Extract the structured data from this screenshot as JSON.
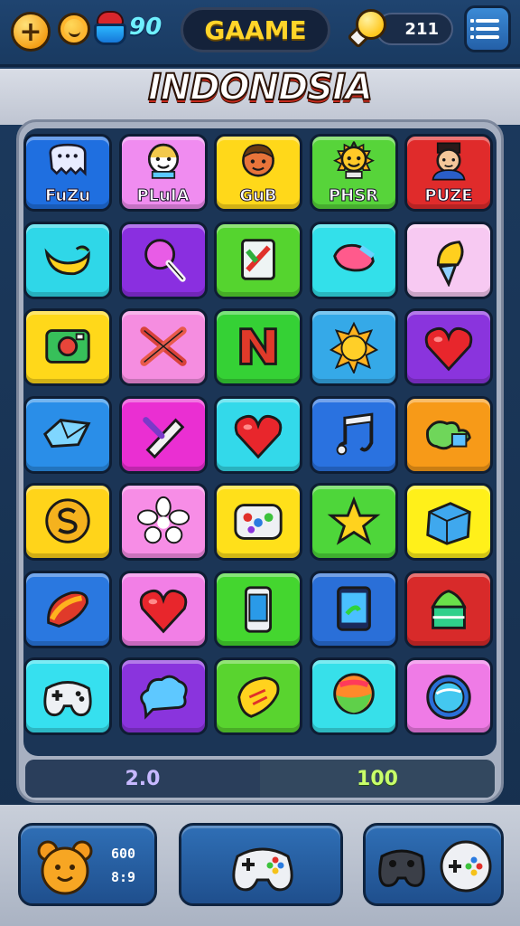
{
  "topbar": {
    "plus_label": "+",
    "gem_count": "90",
    "title": "GAAME",
    "score": "211"
  },
  "banner": {
    "title": "INDONDSIA"
  },
  "board": {
    "tiles": [
      {
        "row": 0,
        "col": 0,
        "color": "#1f6fe0",
        "icon": "ghost-icon",
        "label": "FuZu"
      },
      {
        "row": 0,
        "col": 1,
        "color": "#f08cf0",
        "icon": "smiley-face-icon",
        "label": "PLuIA"
      },
      {
        "row": 0,
        "col": 2,
        "color": "#ffd81a",
        "icon": "boy-face-icon",
        "label": "GuB"
      },
      {
        "row": 0,
        "col": 3,
        "color": "#57d43a",
        "icon": "sun-face-icon",
        "label": "PHSR"
      },
      {
        "row": 0,
        "col": 4,
        "color": "#e02b2b",
        "icon": "man-face-icon",
        "label": "PUZE"
      },
      {
        "row": 1,
        "col": 0,
        "color": "#2fd7e8",
        "icon": "banana-icon",
        "label": ""
      },
      {
        "row": 1,
        "col": 1,
        "color": "#8a2fe0",
        "icon": "lollipop-icon",
        "label": ""
      },
      {
        "row": 1,
        "col": 2,
        "color": "#55d42f",
        "icon": "notebook-icon",
        "label": ""
      },
      {
        "row": 1,
        "col": 3,
        "color": "#33e0ea",
        "icon": "candy-icon",
        "label": ""
      },
      {
        "row": 1,
        "col": 4,
        "color": "#f7c9f2",
        "icon": "ice-cream-icon",
        "label": ""
      },
      {
        "row": 2,
        "col": 0,
        "color": "#ffd81a",
        "icon": "camera-icon",
        "label": ""
      },
      {
        "row": 2,
        "col": 1,
        "color": "#f58de0",
        "icon": "crossed-sticks-icon",
        "label": ""
      },
      {
        "row": 2,
        "col": 2,
        "color": "#35d135",
        "icon": "letter-n-icon",
        "label": ""
      },
      {
        "row": 2,
        "col": 3,
        "color": "#35a9e8",
        "icon": "sun-icon",
        "label": ""
      },
      {
        "row": 2,
        "col": 4,
        "color": "#8a34dd",
        "icon": "heart-icon",
        "label": ""
      },
      {
        "row": 3,
        "col": 0,
        "color": "#2a8ee8",
        "icon": "cube-icon",
        "label": ""
      },
      {
        "row": 3,
        "col": 1,
        "color": "#ea2fd2",
        "icon": "crayon-icon",
        "label": ""
      },
      {
        "row": 3,
        "col": 2,
        "color": "#33d9ea",
        "icon": "heart-icon",
        "label": ""
      },
      {
        "row": 3,
        "col": 3,
        "color": "#2a72e0",
        "icon": "music-note-icon",
        "label": ""
      },
      {
        "row": 3,
        "col": 4,
        "color": "#f79a18",
        "icon": "puzzle-icon",
        "label": ""
      },
      {
        "row": 4,
        "col": 0,
        "color": "#ffd41a",
        "icon": "letter-s-icon",
        "label": ""
      },
      {
        "row": 4,
        "col": 1,
        "color": "#f78de6",
        "icon": "flower-icon",
        "label": ""
      },
      {
        "row": 4,
        "col": 2,
        "color": "#ffe01a",
        "icon": "palette-icon",
        "label": ""
      },
      {
        "row": 4,
        "col": 3,
        "color": "#4ed63a",
        "icon": "star-icon",
        "label": ""
      },
      {
        "row": 4,
        "col": 4,
        "color": "#fff01a",
        "icon": "box-icon",
        "label": ""
      },
      {
        "row": 5,
        "col": 0,
        "color": "#2a78e0",
        "icon": "fan-icon",
        "label": ""
      },
      {
        "row": 5,
        "col": 1,
        "color": "#f27fe6",
        "icon": "heart-icon",
        "label": ""
      },
      {
        "row": 5,
        "col": 2,
        "color": "#44d62f",
        "icon": "phone-icon",
        "label": ""
      },
      {
        "row": 5,
        "col": 3,
        "color": "#2a6fd8",
        "icon": "card-icon",
        "label": ""
      },
      {
        "row": 5,
        "col": 4,
        "color": "#d82a2a",
        "icon": "cake-icon",
        "label": ""
      },
      {
        "row": 6,
        "col": 0,
        "color": "#36e0ef",
        "icon": "gamepad-icon",
        "label": ""
      },
      {
        "row": 6,
        "col": 1,
        "color": "#8a34dd",
        "icon": "cloud-icon",
        "label": ""
      },
      {
        "row": 6,
        "col": 2,
        "color": "#59d42f",
        "icon": "pick-icon",
        "label": ""
      },
      {
        "row": 6,
        "col": 3,
        "color": "#37e0ea",
        "icon": "balloon-icon",
        "label": ""
      },
      {
        "row": 6,
        "col": 4,
        "color": "#ef7be6",
        "icon": "planet-icon",
        "label": ""
      }
    ]
  },
  "score_bar": {
    "left_value": "2.0",
    "right_value": "100"
  },
  "bottom": {
    "stat_top": "600",
    "stat_bottom": "8:9"
  },
  "colors": {
    "background": "#1c3a5e",
    "accent_gold": "#ffd52a",
    "gem_cyan": "#6ff0ff"
  }
}
